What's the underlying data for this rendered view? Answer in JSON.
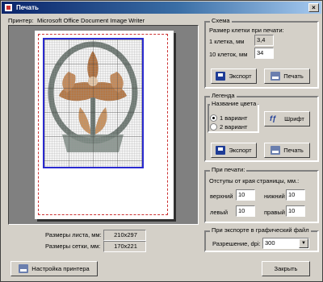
{
  "window": {
    "title": "Печать",
    "close_glyph": "×"
  },
  "printer": {
    "label": "Принтер:",
    "name": "Microsoft Office Document Image Writer"
  },
  "sizes": {
    "sheet_label": "Размеры листа, мм:",
    "sheet_value": "210x297",
    "grid_label": "Размеры сетки, мм:",
    "grid_value": "170x221"
  },
  "scheme": {
    "title": "Схема",
    "cell_size_heading": "Размер клетки при печати:",
    "one_cell_label": "1 клетка, мм",
    "one_cell_value": "3,4",
    "ten_cells_label": "10 клеток, мм",
    "ten_cells_value": "34",
    "export_label": "Экспорт",
    "print_label": "Печать"
  },
  "legend": {
    "title": "Легенда",
    "color_name_heading": "Название цвета",
    "option1": "1 вариант",
    "option2": "2 вариант",
    "selected": "1 вариант",
    "font_label": "Шрифт",
    "export_label": "Экспорт",
    "print_label": "Печать"
  },
  "print_settings": {
    "title": "При печати:",
    "margins_heading": "Отступы от края страницы, мм.:",
    "top_label": "верхний",
    "top_value": "10",
    "bottom_label": "нижний",
    "bottom_value": "10",
    "left_label": "левый",
    "left_value": "10",
    "right_label": "правый",
    "right_value": "10"
  },
  "export_settings": {
    "title": "При экспорте в графический файл",
    "resolution_label": "Разрешение, dpi:",
    "resolution_value": "300"
  },
  "buttons": {
    "printer_setup": "Настройка принтера",
    "close": "Закрыть"
  },
  "icons": {
    "export": "export-icon",
    "print": "printer-icon",
    "font": "font-icon",
    "printer_setup": "printer-setup-icon"
  },
  "colors": {
    "grid_border": "#2a2ad0",
    "margin_dash": "#cc3333",
    "title_bar": "#0a246a",
    "pattern_brown": "#b0713f",
    "pattern_green": "#5b7760"
  }
}
